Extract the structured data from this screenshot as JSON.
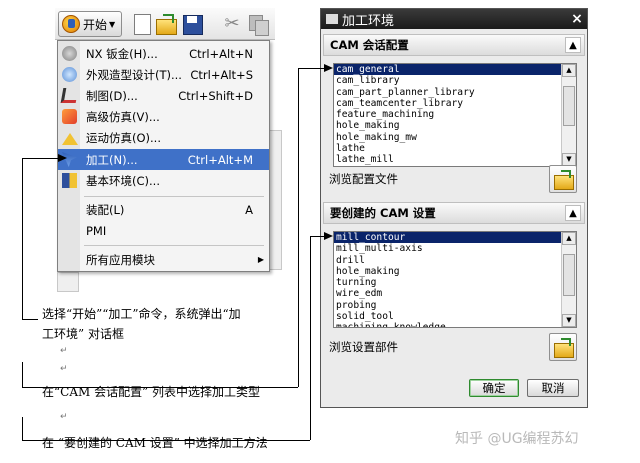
{
  "toolbar": {
    "start_label": "开始",
    "icons": [
      "new-icon",
      "open-icon",
      "save-icon",
      "cut-icon",
      "copy-icon"
    ]
  },
  "start_menu": {
    "items": [
      {
        "label": "NX 钣金(H)...",
        "shortcut": "Ctrl+Alt+N",
        "icon": "sheet-metal-icon"
      },
      {
        "label": "外观造型设计(T)...",
        "shortcut": "Ctrl+Alt+S",
        "icon": "shape-studio-icon"
      },
      {
        "label": "制图(D)...",
        "shortcut": "Ctrl+Shift+D",
        "icon": "drafting-icon"
      },
      {
        "label": "高级仿真(V)...",
        "shortcut": "",
        "icon": "advanced-simulation-icon"
      },
      {
        "label": "运动仿真(O)...",
        "shortcut": "",
        "icon": "motion-simulation-icon"
      },
      {
        "label": "加工(N)...",
        "shortcut": "Ctrl+Alt+M",
        "icon": "manufacturing-icon",
        "selected": true
      },
      {
        "label": "基本环境(C)...",
        "shortcut": "",
        "icon": "gateway-icon"
      },
      {
        "label": "装配(L)",
        "shortcut": "A",
        "icon": ""
      },
      {
        "label": "PMI",
        "shortcut": "",
        "icon": ""
      },
      {
        "label": "所有应用模块",
        "shortcut": "",
        "icon": "",
        "submenu": true
      }
    ]
  },
  "dialog": {
    "title": "加工环境",
    "close": "×",
    "session_section": {
      "header": "CAM 会话配置",
      "items": [
        "cam_general",
        "cam_library",
        "cam_part_planner_library",
        "cam_teamcenter_library",
        "feature_machining",
        "hole_making",
        "hole_making_mw",
        "lathe",
        "lathe_mill"
      ],
      "selected_index": 0,
      "browse_label": "浏览配置文件"
    },
    "setup_section": {
      "header": "要创建的 CAM 设置",
      "items": [
        "mill_contour",
        "mill_multi-axis",
        "drill",
        "hole_making",
        "turning",
        "wire_edm",
        "probing",
        "solid_tool",
        "machining_knowledge"
      ],
      "selected_index": 0,
      "browse_label": "浏览设置部件"
    },
    "ok_label": "确定",
    "cancel_label": "取消"
  },
  "annotations": {
    "step1": "选择“开始”“加工”命令，系统弹出“加",
    "step1b": "工环境” 对话框",
    "step2": "在“CAM 会话配置” 列表中选择加工类型",
    "step3": "在 “要创建的 CAM 设置” 中选择加工方法",
    "paragraph_mark": "↵"
  },
  "watermark": "知乎 @UG编程苏幻"
}
